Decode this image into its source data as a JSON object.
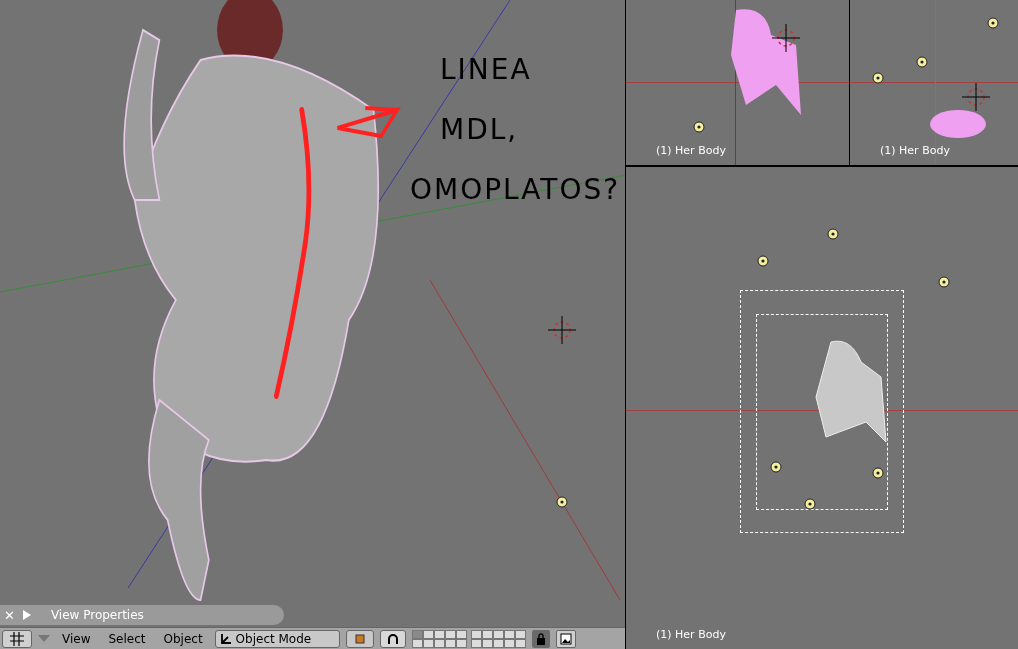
{
  "annotation": {
    "lines": [
      "LINEA",
      "MDL,",
      "OMOPLATOS?"
    ]
  },
  "properties_panel": {
    "close": "✕",
    "title": "View Properties"
  },
  "header": {
    "menus": [
      "View",
      "Select",
      "Object"
    ],
    "mode": "Object Mode",
    "lock": {
      "on": true
    }
  },
  "layers": [
    {
      "selected": true
    },
    {
      "selected": false
    },
    {
      "selected": false
    },
    {
      "selected": false
    },
    {
      "selected": false
    },
    {
      "selected": false
    },
    {
      "selected": false
    },
    {
      "selected": false
    },
    {
      "selected": false
    },
    {
      "selected": false
    },
    {
      "selected": false
    },
    {
      "selected": false
    },
    {
      "selected": false
    },
    {
      "selected": false
    },
    {
      "selected": false
    },
    {
      "selected": false
    },
    {
      "selected": false
    },
    {
      "selected": false
    },
    {
      "selected": false
    },
    {
      "selected": false
    }
  ],
  "viewports": [
    {
      "label": "(1) Her Body"
    },
    {
      "label": "(1) Her Body"
    },
    {
      "label": "(1) Her Body"
    }
  ]
}
